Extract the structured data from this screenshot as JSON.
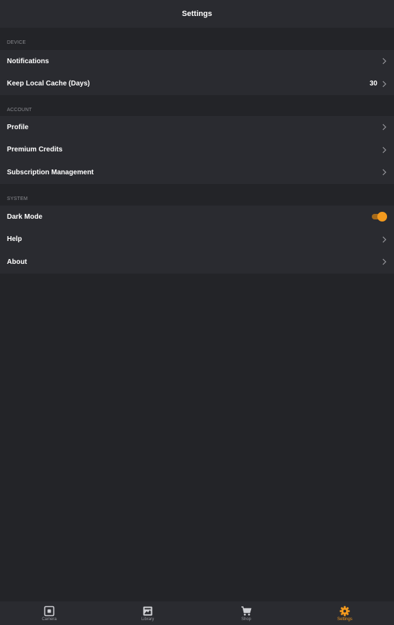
{
  "header": {
    "title": "Settings"
  },
  "sections": {
    "device": {
      "title": "DEVICE",
      "notifications_label": "Notifications",
      "cache_label": "Keep Local Cache (Days)",
      "cache_value": "30"
    },
    "account": {
      "title": "ACCOUNT",
      "profile_label": "Profile",
      "premium_label": "Premium Credits",
      "subscription_label": "Subscription Management"
    },
    "system": {
      "title": "SYSTEM",
      "dark_mode_label": "Dark Mode",
      "dark_mode_on": true,
      "help_label": "Help",
      "about_label": "About"
    }
  },
  "tabbar": {
    "camera": "Camera",
    "library": "Library",
    "shop": "Shop",
    "settings": "Settings",
    "active": "settings"
  },
  "colors": {
    "background": "#232428",
    "surface": "#2a2b30",
    "accent": "#f39a1e",
    "muted_text": "#8b8c91"
  }
}
